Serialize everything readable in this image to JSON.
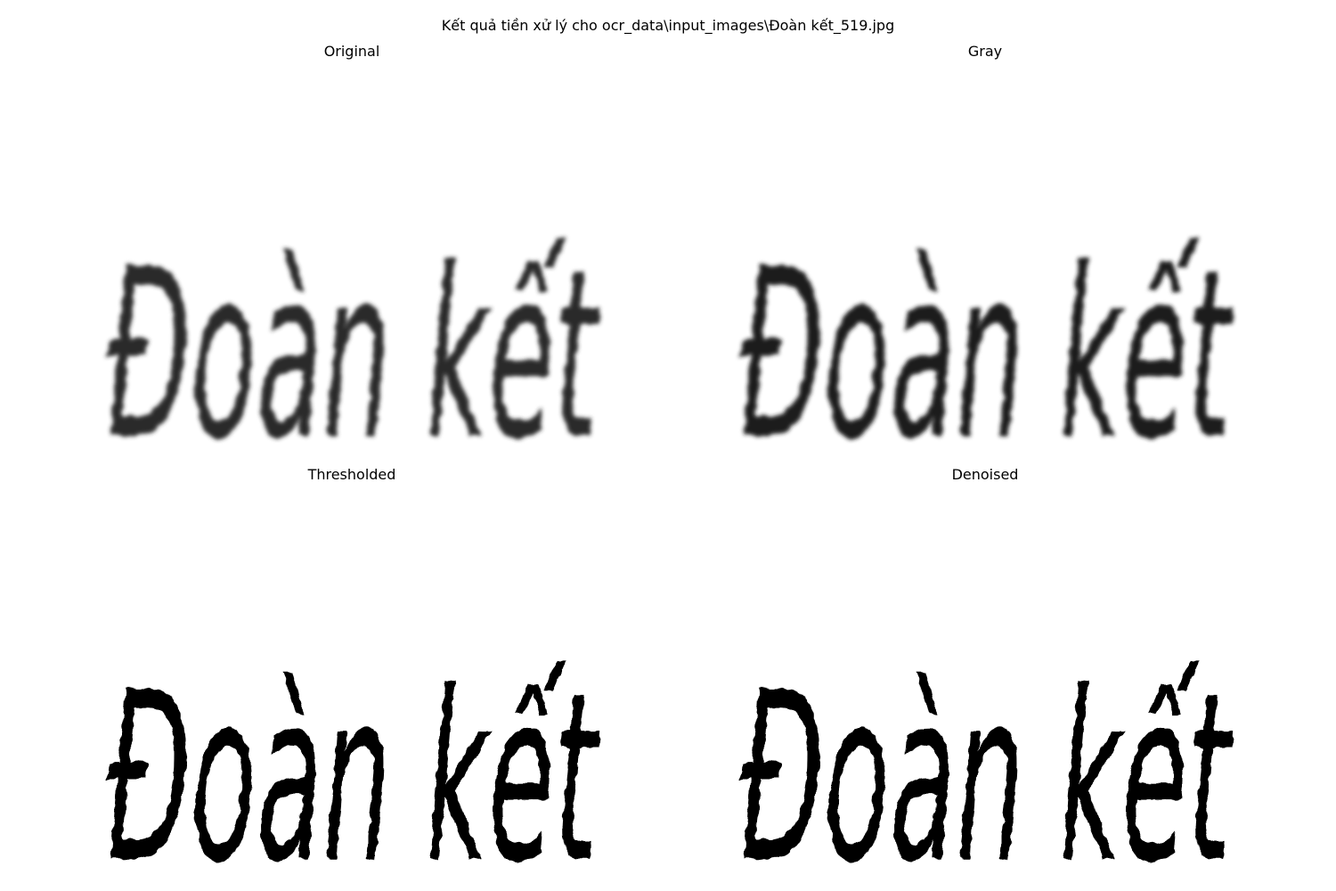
{
  "figure": {
    "suptitle": "Kết quả tiền xử lý cho ocr_data\\input_images\\Đoàn kết_519.jpg"
  },
  "panels": [
    {
      "title": "Original",
      "image_text": "Đoàn kết",
      "style": "blurred",
      "fill": "#2b2b2b"
    },
    {
      "title": "Gray",
      "image_text": "Đoàn kết",
      "style": "blurred",
      "fill": "#1e1e1e"
    },
    {
      "title": "Thresholded",
      "image_text": "Đoàn kết",
      "style": "binary",
      "fill": "#000000"
    },
    {
      "title": "Denoised",
      "image_text": "Đoàn kết",
      "style": "binary",
      "fill": "#000000"
    }
  ]
}
